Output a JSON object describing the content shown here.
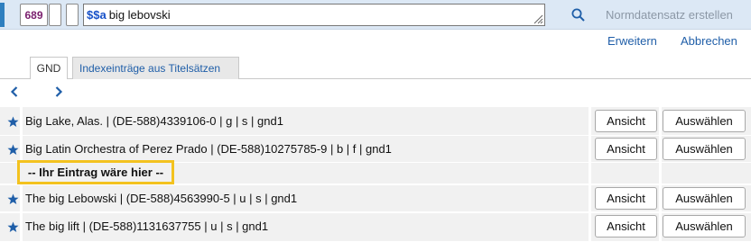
{
  "topbar": {
    "tag": "689",
    "field_subfield": "$$a",
    "field_value": "big lebovski",
    "create_label": "Normdatensatz erstellen"
  },
  "links": {
    "extend": "Erweitern",
    "cancel": "Abbrechen"
  },
  "tabs": [
    {
      "label": "GND",
      "active": true
    },
    {
      "label": "Indexeinträge aus Titelsätzen",
      "active": false
    }
  ],
  "results": [
    {
      "text": "Big Lake, Alas. | (DE-588)4339106-0 | g | s | gnd1",
      "view": "Ansicht",
      "select": "Auswählen"
    },
    {
      "text": "Big Latin Orchestra of Perez Prado | (DE-588)10275785-9 | b | f | gnd1",
      "view": "Ansicht",
      "select": "Auswählen"
    },
    {
      "text": "The big Lebowski | (DE-588)4563990-5 | u | s | gnd1",
      "view": "Ansicht",
      "select": "Auswählen"
    },
    {
      "text": "The big lift | (DE-588)1131637755 | u | s | gnd1",
      "view": "Ansicht",
      "select": "Auswählen"
    }
  ],
  "placeholder": "-- Ihr Eintrag wäre hier --",
  "colors": {
    "star": "#1f5ea8",
    "highlight_border": "#f3c21f",
    "topbar_bg": "#dce8f5"
  },
  "icons": [
    "star-icon",
    "search-icon",
    "chevron-left-icon",
    "chevron-right-icon",
    "resize-handle-icon"
  ]
}
